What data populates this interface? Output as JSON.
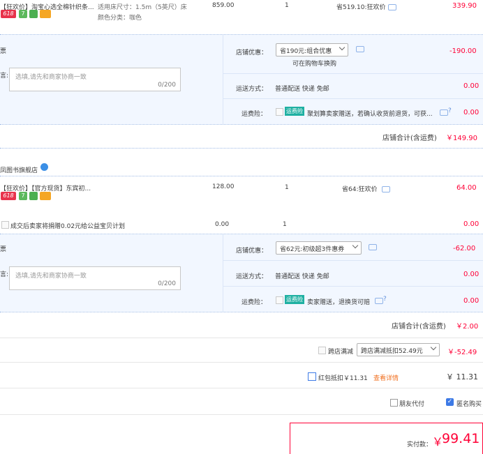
{
  "shop1": {
    "item": {
      "title": "【狂欢价】淘宝心选全棉针织条...",
      "sku_size": "适用床尺寸：1.5m（5英尺）床",
      "sku_color": "颜色分类：咖色",
      "price": "859.00",
      "qty": "1",
      "saving": "省519.10:狂欢价",
      "subtotal": "339.90"
    },
    "badges": [
      "618",
      "7",
      "",
      ""
    ],
    "coupon_label_left": "票",
    "message_label_left": "言:",
    "message_placeholder": "选填,请先和商家协商一致",
    "message_counter": "0/200",
    "shop_discount_label": "店铺优惠：",
    "shop_discount_value": "省190元:组合优惠",
    "shop_discount_hint": "可在购物车换购",
    "shop_discount_amount": "-190.00",
    "shipping_label": "运送方式：",
    "shipping_value": "普通配送 快递 免邮",
    "shipping_amount": "0.00",
    "insurance_label": "运费险：",
    "insurance_tag": "运费险",
    "insurance_text": "聚划算卖家赠送，若确认收货前退货，可获...",
    "insurance_amount": "0.00",
    "total_label": "店铺合计(含运费)",
    "total_value": "￥149.90"
  },
  "shop2": {
    "name": "凤图书旗舰店",
    "item": {
      "title": "【狂欢价】【官方现货】东宾初...",
      "price": "128.00",
      "qty": "1",
      "saving": "省64:狂欢价",
      "subtotal": "64.00"
    },
    "badges": [
      "618",
      "7",
      "",
      ""
    ],
    "charity_text": "成交后卖家将捐赠0.02元给公益宝贝计划",
    "charity_price": "0.00",
    "charity_qty": "1",
    "charity_subtotal": "0.00",
    "coupon_label_left": "票",
    "message_label_left": "言:",
    "message_placeholder": "选填,请先和商家协商一致",
    "message_counter": "0/200",
    "shop_discount_label": "店铺优惠：",
    "shop_discount_value": "省62元:初级超3件惠券",
    "shop_discount_amount": "-62.00",
    "shipping_label": "运送方式：",
    "shipping_value": "普通配送 快递 免邮",
    "shipping_amount": "0.00",
    "insurance_label": "运费险：",
    "insurance_tag": "运费险",
    "insurance_text": "卖家赠送，退换货可赔",
    "insurance_amount": "0.00",
    "total_label": "店铺合计(含运费)",
    "total_value": "￥2.00"
  },
  "cross_store": {
    "label": "跨店满减",
    "select_value": "跨店满减抵扣52.49元",
    "amount": "￥-52.49"
  },
  "red_packet": {
    "label": "红包抵扣￥11.31",
    "details_link": "查看详情",
    "amount": "￥ 11.31"
  },
  "options": {
    "friend_pay": "朋友代付",
    "anonymous": "匿名购买"
  },
  "pay": {
    "label": "实付款：",
    "currency": "￥",
    "amount": "99.41"
  },
  "colors": {
    "accent_red": "#ff0036",
    "light_blue_bg": "#f2f7ff",
    "tag_teal": "#1fb0a2",
    "checkbox_blue": "#3d7ae6"
  }
}
